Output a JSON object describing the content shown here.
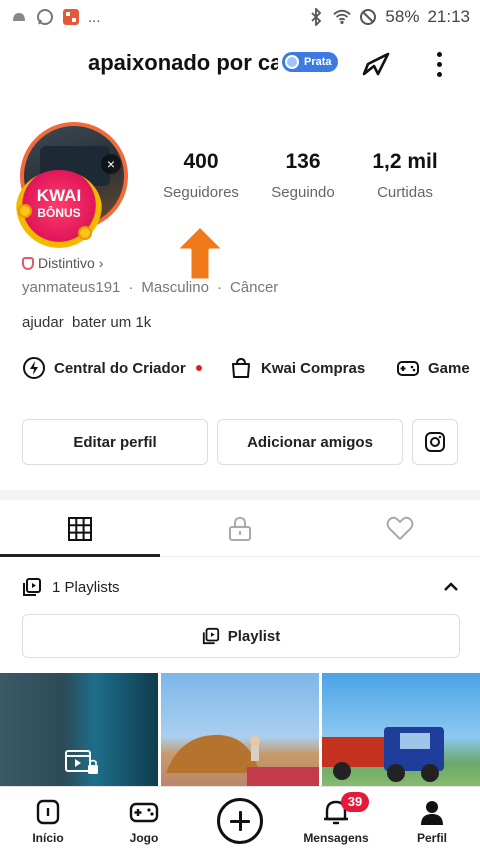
{
  "status_bar": {
    "notification_more": "...",
    "battery": "58%",
    "time": "21:13",
    "icons": [
      "notification-dot-icon",
      "whatsapp-icon",
      "app-icon",
      "bluetooth-icon",
      "wifi-icon",
      "do-not-disturb-icon"
    ]
  },
  "header": {
    "profile_name": "apaixonado por ca",
    "rank_badge": "Prata",
    "icons": [
      "share-icon",
      "more-vertical-icon"
    ]
  },
  "avatar": {
    "bonus_title": "KWAI",
    "bonus_subtitle": "BÔNUS"
  },
  "stats": [
    {
      "value": "400",
      "label": "Seguidores"
    },
    {
      "value": "136",
      "label": "Seguindo"
    },
    {
      "value": "1,2 mil",
      "label": "Curtidas"
    }
  ],
  "profile": {
    "badge_label": "Distintivo",
    "username": "yanmateus191",
    "gender": "Masculino",
    "zodiac": "Câncer",
    "bio": "ajudar  bater um 1k"
  },
  "quick_links": [
    {
      "label": "Central do Criador",
      "icon": "creator-bolt-icon"
    },
    {
      "label": "Kwai Compras",
      "icon": "shopping-bag-icon"
    },
    {
      "label": "Game",
      "icon": "gamepad-icon"
    }
  ],
  "actions": {
    "edit_profile": "Editar perfil",
    "add_friends": "Adicionar amigos"
  },
  "tabs": [
    {
      "icon": "grid-icon",
      "active": true
    },
    {
      "icon": "lock-icon",
      "active": false
    },
    {
      "icon": "heart-icon",
      "active": false
    }
  ],
  "playlists": {
    "header": "1 Playlists",
    "button": "Playlist"
  },
  "bottom_nav": [
    {
      "label": "Início"
    },
    {
      "label": "Jogo"
    },
    {
      "label": ""
    },
    {
      "label": "Mensagens",
      "badge": "39"
    },
    {
      "label": "Perfil"
    }
  ],
  "colors": {
    "accent_orange": "#f07a1a",
    "badge_red": "#e5193a",
    "rank_blue": "#3d7be0"
  }
}
